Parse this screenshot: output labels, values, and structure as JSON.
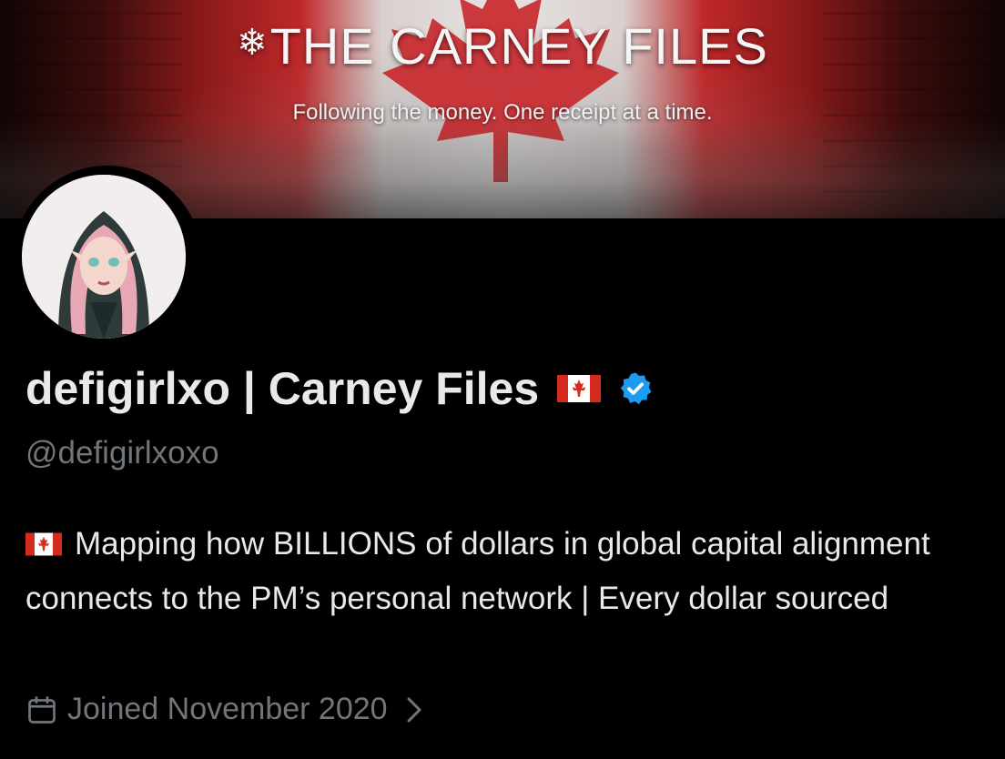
{
  "banner": {
    "title": "THE CARNEY FILES",
    "subtitle": "Following the money. One receipt at a time."
  },
  "profile": {
    "display_name": "defigirlxo | Carney Files",
    "handle": "@defigirlxoxo",
    "verified": true,
    "bio": "Mapping how BILLIONS of dollars in global capital alignment connects to the PM’s personal network | Every dollar sourced",
    "joined": "Joined November 2020"
  },
  "icons": {
    "flag": "canada-flag-icon",
    "verified": "verified-badge-icon",
    "calendar": "calendar-icon",
    "chevron": "chevron-right-icon"
  },
  "colors": {
    "background": "#000000",
    "text": "#e7e9ea",
    "muted": "#71767b",
    "verified": "#1d9bf0",
    "flag_red": "#d52b1e"
  }
}
